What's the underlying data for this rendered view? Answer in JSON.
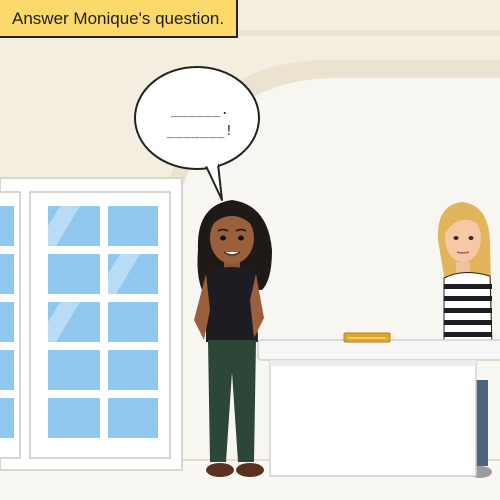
{
  "instruction": {
    "text": "Answer Monique's question."
  },
  "speech_bubble": {
    "line1": "______.",
    "line2": "_______!"
  },
  "colors": {
    "wall": "#f3eee0",
    "arch": "#eee8d8",
    "floor": "#f8f7f3",
    "instruction_bg": "#fbd96b",
    "glass": "#8fc7ef",
    "counter": "#ffffff",
    "book": "#e0a72c"
  }
}
